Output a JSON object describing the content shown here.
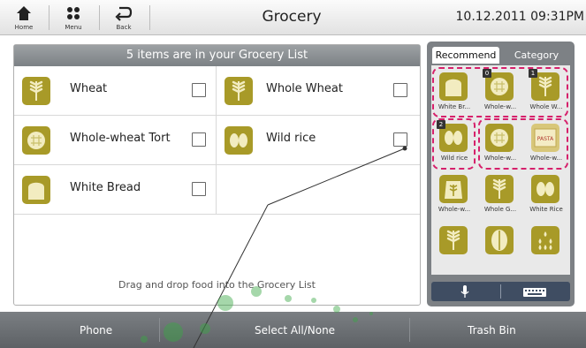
{
  "header": {
    "title": "Grocery",
    "datetime": "10.12.2011 09:31PM",
    "nav": [
      {
        "label": "Home",
        "icon": "home-icon"
      },
      {
        "label": "Menu",
        "icon": "menu-icon"
      },
      {
        "label": "Back",
        "icon": "back-icon"
      }
    ]
  },
  "grocery_list": {
    "header": "5 items are in your Grocery List",
    "items": [
      {
        "name": "Wheat",
        "icon": "wheat-icon"
      },
      {
        "name": "Whole Wheat",
        "icon": "wheat-icon"
      },
      {
        "name": "Whole-wheat Tort",
        "icon": "tortilla-icon"
      },
      {
        "name": "Wild rice",
        "icon": "rice-icon"
      },
      {
        "name": "White Bread",
        "icon": "bread-icon"
      }
    ],
    "drag_hint": "Drag and drop food into the Grocery List"
  },
  "food_panel": {
    "tabs": [
      "Recommend",
      "Category"
    ],
    "active_tab": "Recommend",
    "tiles": [
      {
        "label": "White Br...",
        "icon": "bread-icon",
        "badge": ""
      },
      {
        "label": "Whole-w...",
        "icon": "tortilla-icon",
        "badge": "0"
      },
      {
        "label": "Whole W...",
        "icon": "wheat-icon",
        "badge": "1"
      },
      {
        "label": "Wild rice",
        "icon": "rice-icon",
        "badge": "2"
      },
      {
        "label": "Whole-w...",
        "icon": "tortilla-icon",
        "badge": ""
      },
      {
        "label": "Whole-w...",
        "icon": "pasta-icon",
        "badge": ""
      },
      {
        "label": "Whole-w...",
        "icon": "wheat-bag-icon",
        "badge": ""
      },
      {
        "label": "Whole G...",
        "icon": "wheat-icon",
        "badge": ""
      },
      {
        "label": "White Rice",
        "icon": "rice-icon",
        "badge": ""
      },
      {
        "label": "",
        "icon": "wheat-icon",
        "badge": ""
      },
      {
        "label": "",
        "icon": "grain-icon",
        "badge": ""
      },
      {
        "label": "",
        "icon": "seeds-icon",
        "badge": ""
      }
    ],
    "pasta_text": "PASTA",
    "controls": [
      {
        "icon": "microphone-icon"
      },
      {
        "icon": "keyboard-icon"
      }
    ]
  },
  "footer": {
    "buttons": [
      "Phone",
      "Select All/None",
      "Trash Bin"
    ]
  },
  "colors": {
    "icon_bg": "#a89a28",
    "icon_light": "#e8e0a0",
    "highlight": "#d6206b",
    "panel_grey": "#7d8185"
  }
}
